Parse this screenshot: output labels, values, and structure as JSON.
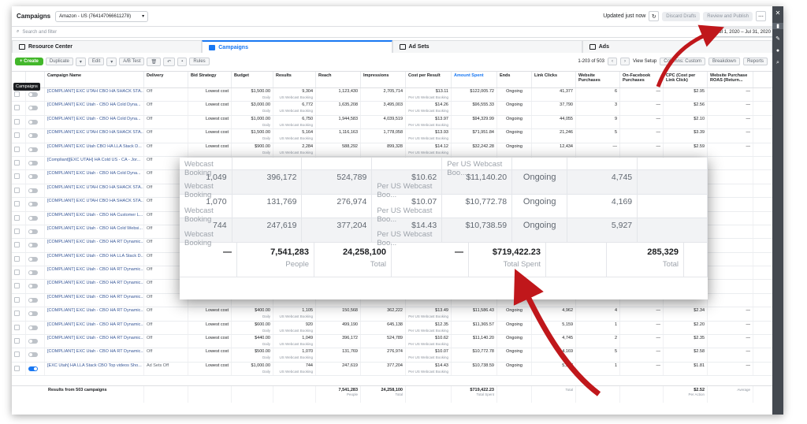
{
  "app": {
    "title": "Campaigns",
    "account": "Amazon - US (764147066611278)",
    "updated": "Updated just now",
    "discard": "Discard Drafts",
    "review": "Review and Publish",
    "search_placeholder": "Search and filter",
    "date_range": "Jul 1, 2020 – Jul 31, 2020"
  },
  "tabs": [
    "Resource Center",
    "Campaigns",
    "Ad Sets",
    "Ads"
  ],
  "toolbar": {
    "create": "Create",
    "duplicate": "Duplicate",
    "edit": "Edit",
    "ab_test": "A/B Test",
    "rules": "Rules",
    "pagination": "1-203 of 503",
    "view_setup": "View Setup",
    "columns": "Columns: Custom",
    "breakdown": "Breakdown",
    "reports": "Reports"
  },
  "tooltip": "Campaigns",
  "columns": [
    "Campaign Name",
    "Delivery",
    "Bid Strategy",
    "Budget",
    "Results",
    "Reach",
    "Impressions",
    "Cost per Result",
    "Amount Spent",
    "Ends",
    "Link Clicks",
    "Website Purchases",
    "On-Facebook Purchases",
    "CPC (Cost per Link Click)",
    "Website Purchase ROAS (Return..."
  ],
  "rows": [
    {
      "name": "[COMPLIANT] EXC UTAH CBO HA SHACK STA...",
      "delivery": "Off",
      "bid": "Lowest cost",
      "budget": "$1,500.00",
      "results": "9,304",
      "reach": "1,123,430",
      "impr": "2,705,714",
      "cpr": "$13.11",
      "spent": "$122,005.72",
      "ends": "Ongoing",
      "clicks": "41,377",
      "wp": "6",
      "fbp": "—",
      "cpc": "$2.95",
      "roas": "—"
    },
    {
      "name": "[COMPLIANT] EXC Utah - CBO HA Cold Dyna...",
      "delivery": "Off",
      "bid": "Lowest cost",
      "budget": "$3,000.00",
      "results": "6,772",
      "reach": "1,635,208",
      "impr": "3,495,003",
      "cpr": "$14.26",
      "spent": "$96,555.33",
      "ends": "Ongoing",
      "clicks": "37,790",
      "wp": "3",
      "fbp": "—",
      "cpc": "$2.56",
      "roas": "—"
    },
    {
      "name": "[COMPLIANT] EXC Utah - CBO HA Cold Dyna...",
      "delivery": "Off",
      "bid": "Lowest cost",
      "budget": "$1,000.00",
      "results": "6,750",
      "reach": "1,944,583",
      "impr": "4,039,519",
      "cpr": "$13.97",
      "spent": "$94,329.99",
      "ends": "Ongoing",
      "clicks": "44,055",
      "wp": "9",
      "fbp": "—",
      "cpc": "$2.10",
      "roas": "—"
    },
    {
      "name": "[COMPLIANT] EXC UTAH CBO HA SHACK STA...",
      "delivery": "Off",
      "bid": "Lowest cost",
      "budget": "$1,500.00",
      "results": "5,164",
      "reach": "1,116,163",
      "impr": "1,778,058",
      "cpr": "$13.93",
      "spent": "$71,951.84",
      "ends": "Ongoing",
      "clicks": "21,246",
      "wp": "5",
      "fbp": "—",
      "cpc": "$3.39",
      "roas": "—"
    },
    {
      "name": "[COMPLIANT] EXC Utah CBO HA LLA Stack D...",
      "delivery": "Off",
      "bid": "Lowest cost",
      "budget": "$900.00",
      "results": "2,284",
      "reach": "588,292",
      "impr": "899,328",
      "cpr": "$14.12",
      "spent": "$32,242.28",
      "ends": "Ongoing",
      "clicks": "12,434",
      "wp": "—",
      "fbp": "—",
      "cpc": "$2.59",
      "roas": "—"
    },
    {
      "name": "[Compliant][EXC UTAH] HA Cold US - CA - Jor...",
      "delivery": "Off"
    },
    {
      "name": "[COMPLIANT] EXC Utah - CBO HA Cold Dyna...",
      "delivery": "Off"
    },
    {
      "name": "[COMPLIANT] EXC UTAH CBO HA SHACK STA...",
      "delivery": "Off"
    },
    {
      "name": "[COMPLIANT] EXC UTAH CBO HA SHACK STA...",
      "delivery": "Off"
    },
    {
      "name": "[COMPLIANT] EXC Utah - CBO HA Customer L...",
      "delivery": "Off"
    },
    {
      "name": "[COMPLIANT] EXC Utah - CBO HA Cold Websi...",
      "delivery": "Off"
    },
    {
      "name": "[COMPLIANT] EXC Utah - CBO HA RT Dynamic...",
      "delivery": "Off"
    },
    {
      "name": "[COMPLIANT] EXC Utah - CBO HA LLA Stack D...",
      "delivery": "Off"
    },
    {
      "name": "[COMPLIANT] EXC Utah - CBO HA RT Dynamic...",
      "delivery": "Off"
    },
    {
      "name": "[COMPLIANT] EXC Utah - CBO HA RT Dynamic...",
      "delivery": "Off"
    },
    {
      "name": "[COMPLIANT] EXC Utah - CBO HA RT Dynamic...",
      "delivery": "Off"
    },
    {
      "name": "[COMPLIANT] EXC Utah - CBO HA RT Dynamic...",
      "delivery": "Off",
      "bid": "Lowest cost",
      "budget": "$400.00",
      "results": "1,105",
      "reach": "150,568",
      "impr": "362,222",
      "cpr": "$13.49",
      "spent": "$11,586.43",
      "ends": "Ongoing",
      "clicks": "4,962",
      "wp": "4",
      "fbp": "—",
      "cpc": "$2.34",
      "roas": "—"
    },
    {
      "name": "[COMPLIANT] EXC Utah - CBO HA RT Dynamic...",
      "delivery": "Off",
      "bid": "Lowest cost",
      "budget": "$600.00",
      "results": "920",
      "reach": "499,190",
      "impr": "645,138",
      "cpr": "$12.35",
      "spent": "$11,365.57",
      "ends": "Ongoing",
      "clicks": "5,159",
      "wp": "1",
      "fbp": "—",
      "cpc": "$2.20",
      "roas": "—"
    },
    {
      "name": "[COMPLIANT] EXC Utah - CBO HA RT Dynamic...",
      "delivery": "Off",
      "bid": "Lowest cost",
      "budget": "$440.00",
      "results": "1,049",
      "reach": "396,172",
      "impr": "524,789",
      "cpr": "$10.62",
      "spent": "$11,140.20",
      "ends": "Ongoing",
      "clicks": "4,745",
      "wp": "2",
      "fbp": "—",
      "cpc": "$2.35",
      "roas": "—"
    },
    {
      "name": "[COMPLIANT] EXC Utah - CBO HA RT Dynamic...",
      "delivery": "Off",
      "bid": "Lowest cost",
      "budget": "$500.00",
      "results": "1,070",
      "reach": "131,769",
      "impr": "276,974",
      "cpr": "$10.07",
      "spent": "$10,772.78",
      "ends": "Ongoing",
      "clicks": "4,169",
      "wp": "5",
      "fbp": "—",
      "cpc": "$2.58",
      "roas": "—"
    },
    {
      "name": "[EXC Utah] HA LLA Stack CBO Top videos Sho...",
      "delivery": "Ad Sets Off",
      "bid": "Lowest cost",
      "budget": "$1,000.00",
      "results": "744",
      "reach": "247,619",
      "impr": "377,204",
      "cpr": "$14.43",
      "spent": "$10,738.59",
      "ends": "Ongoing",
      "clicks": "5,927",
      "wp": "1",
      "fbp": "—",
      "cpc": "$1.81",
      "roas": "—",
      "on": true
    }
  ],
  "result_sub": "US Webcast Booking",
  "cpr_sub": "Per US Webcast Booking",
  "budget_sub": "Daily",
  "totals": {
    "label": "Results from 503 campaigns",
    "reach": "7,541,283",
    "reach_sub": "People",
    "impr": "24,258,100",
    "impr_sub": "Total",
    "spent": "$719,422.23",
    "spent_sub": "Total Spent",
    "clicks_sub": "Total",
    "cpc": "$2.52",
    "cpc_sub": "Per Action",
    "roas_sub": "Average"
  },
  "zoom": {
    "header_sub": "Webcast Booking",
    "header_cpr": "Per US Webcast Boo...",
    "rows": [
      {
        "results": "1,049",
        "sub": "Webcast Booking",
        "reach": "396,172",
        "impr": "524,789",
        "cpr": "$10.62",
        "cpr_sub": "Per US Webcast Boo...",
        "spent": "$11,140.20",
        "ends": "Ongoing",
        "clicks": "4,745"
      },
      {
        "results": "1,070",
        "sub": "Webcast Booking",
        "reach": "131,769",
        "impr": "276,974",
        "cpr": "$10.07",
        "cpr_sub": "Per US Webcast Boo...",
        "spent": "$10,772.78",
        "ends": "Ongoing",
        "clicks": "4,169"
      },
      {
        "results": "744",
        "sub": "Webcast Booking",
        "reach": "247,619",
        "impr": "377,204",
        "cpr": "$14.43",
        "cpr_sub": "Per US Webcast Boo...",
        "spent": "$10,738.59",
        "ends": "Ongoing",
        "clicks": "5,927"
      }
    ],
    "total_dash": "—",
    "total_reach": "7,541,283",
    "total_reach_sub": "People",
    "total_impr": "24,258,100",
    "total_impr_sub": "Total",
    "total_dash2": "—",
    "total_spent": "$719,422.23",
    "total_spent_sub": "Total Spent",
    "total_clicks": "285,329",
    "total_clicks_sub": "Total"
  },
  "colors": {
    "accent": "#1877f2",
    "create": "#42b72a",
    "arrow": "#c0171b"
  }
}
